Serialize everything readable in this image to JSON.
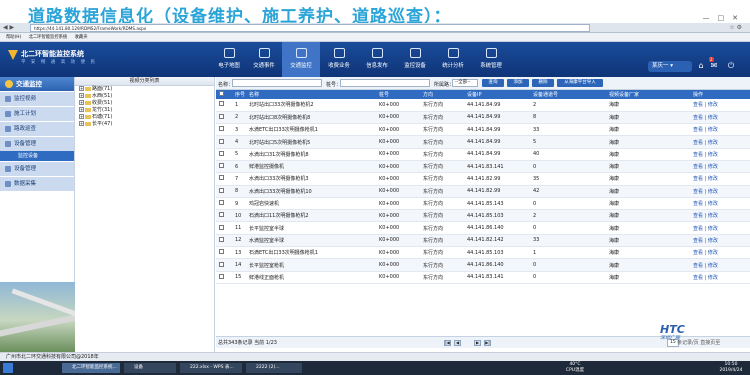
{
  "slide_title": "道路数据信息化（设备维护、施工养护、道路巡查）：",
  "browser": {
    "url": "https://44.141.80.129/RDMS2/FrameWork/RDMS.aspx",
    "favorites": [
      "帮助(H)",
      "北二环智能监控系统",
      "收藏夹"
    ]
  },
  "app": {
    "logo_title": "北二环智能监控系统",
    "logo_subtitle": "平 安 畅 通    高 效 便 民",
    "nav": [
      "电子地图",
      "交通事件",
      "交通监控",
      "收费业务",
      "信息发布",
      "监控设备",
      "统计分析",
      "系统管理"
    ],
    "active_nav": "交通监控",
    "user": "某庆一",
    "mail_count": "2"
  },
  "sidebar": {
    "header": "交通监控",
    "items": [
      "监控视频",
      "施工计划",
      "路政巡查",
      "设备管理"
    ],
    "subitem": "监控设备",
    "items_after": [
      "设备管理",
      "数据采集"
    ]
  },
  "tree": {
    "header": "视频分类列表",
    "nodes": [
      "路面(71)",
      "水西(51)",
      "收费(51)",
      "龙竹(31)",
      "石塘(71)",
      "长平(47)"
    ]
  },
  "search": {
    "name_label": "名称：",
    "stake_label": "桩号：",
    "direction_select": "--全部--",
    "direction_label": "所属路：",
    "buttons": [
      "查询",
      "添加",
      "删除",
      "从海康平台导入"
    ]
  },
  "table": {
    "headers": [
      "序号",
      "名称",
      "桩号",
      "方向",
      "设备IP",
      "设备通道号",
      "视频设备厂家",
      "操作"
    ],
    "rows": [
      [
        "1",
        "北时站出口33次明摄像枪机2",
        "K0+000",
        "东行方向",
        "44.141.84.99",
        "2",
        "海康",
        "查看 | 修改"
      ],
      [
        "2",
        "北时站出口8次明摄像枪机8",
        "K0+000",
        "东行方向",
        "44.141.84.99",
        "8",
        "海康",
        "查看 | 修改"
      ],
      [
        "3",
        "水滴ETC出口33次明摄像枪机1",
        "K0+000",
        "东行方向",
        "44.141.84.99",
        "33",
        "海康",
        "查看 | 修改"
      ],
      [
        "4",
        "北时站出口5次明摄像枪机5",
        "K0+000",
        "东行方向",
        "44.141.84.99",
        "5",
        "海康",
        "查看 | 修改"
      ],
      [
        "5",
        "水滴出口31次明摄像枪机8",
        "K0+000",
        "东行方向",
        "44.141.84.99",
        "40",
        "海康",
        "查看 | 修改"
      ],
      [
        "6",
        "鲜港监控摄像机",
        "K0+000",
        "东行方向",
        "44.141.83.141",
        "0",
        "海康",
        "查看 | 修改"
      ],
      [
        "7",
        "水滴出口33次明摄像枪机3",
        "K0+000",
        "东行方向",
        "44.141.82.99",
        "35",
        "海康",
        "查看 | 修改"
      ],
      [
        "8",
        "水滴出口33次明摄像枪机10",
        "K0+000",
        "东行方向",
        "44.141.82.99",
        "42",
        "海康",
        "查看 | 修改"
      ],
      [
        "9",
        "鸡冠岩快速机",
        "K0+000",
        "东行方向",
        "44.141.85.143",
        "0",
        "海康",
        "查看 | 修改"
      ],
      [
        "10",
        "石滴出口11次明摄像枪机2",
        "K0+000",
        "东行方向",
        "44.141.85.103",
        "2",
        "海康",
        "查看 | 修改"
      ],
      [
        "11",
        "长平监控室半球",
        "K0+000",
        "东行方向",
        "44.141.86.140",
        "0",
        "海康",
        "查看 | 修改"
      ],
      [
        "12",
        "水滴监控室半球",
        "K0+000",
        "东行方向",
        "44.141.82.142",
        "33",
        "海康",
        "查看 | 修改"
      ],
      [
        "13",
        "石滴ETC出口33次明摄像枪机1",
        "K0+000",
        "东行方向",
        "44.141.85.103",
        "1",
        "海康",
        "查看 | 修改"
      ],
      [
        "14",
        "长平监控室枪机",
        "K0+000",
        "东行方向",
        "44.141.86.140",
        "0",
        "海康",
        "查看 | 修改"
      ],
      [
        "15",
        "鲜港线正面枪机",
        "K0+000",
        "东行方向",
        "44.141.83.141",
        "0",
        "海康",
        "查看 | 修改"
      ]
    ]
  },
  "pager": {
    "info": "总共343条记录  当前 1/23",
    "page_size": "15",
    "page_size_desc": "条记录/页  直接页至"
  },
  "watermark": {
    "brand": "HTC",
    "sub": "深圳广辰"
  },
  "footer": "广州市北二环交通科技有限公司@2018年",
  "taskbar": {
    "tasks": [
      "北二环智能监控系统...",
      "设备",
      "222.xlsx - WPS 表...",
      "2222 (2)..."
    ],
    "weather": "40°C",
    "weather_sub": "CPU温度",
    "time": "10:50",
    "date": "2019/4/24"
  }
}
